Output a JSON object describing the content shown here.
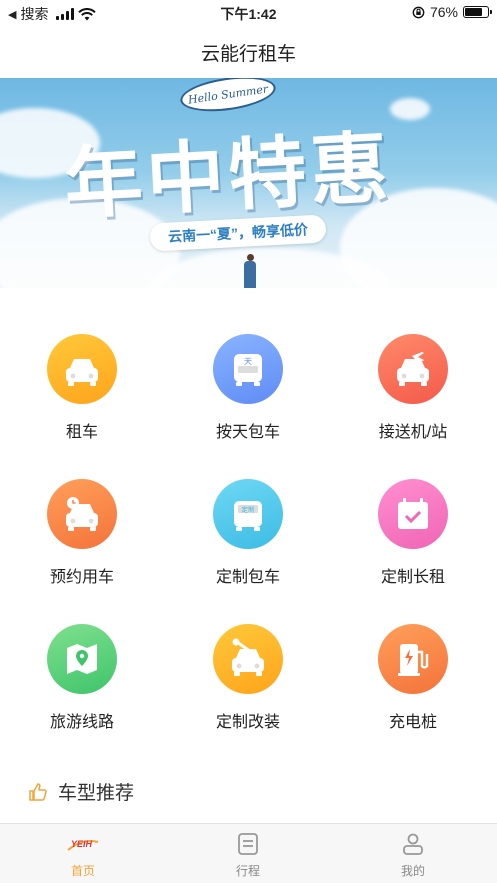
{
  "status_bar": {
    "back_app": "搜索",
    "time": "下午1:42",
    "battery_percent": "76%",
    "battery_level": 0.76
  },
  "nav": {
    "title": "云能行租车"
  },
  "banner": {
    "badge": "Hello Summer",
    "headline": "年中特惠",
    "slogan": "云南一“夏”，畅享低价"
  },
  "services": [
    {
      "label": "租车",
      "icon": "car-icon",
      "color_from": "#ffc93a",
      "color_to": "#ffa41c"
    },
    {
      "label": "按天包车",
      "icon": "day-bus-icon",
      "color_from": "#8ab4ff",
      "color_to": "#5e8cf5"
    },
    {
      "label": "接送机/站",
      "icon": "airport-car-icon",
      "color_from": "#ff8a6a",
      "color_to": "#f45a4a"
    },
    {
      "label": "预约用车",
      "icon": "clock-car-icon",
      "color_from": "#ff9f5a",
      "color_to": "#f4733a"
    },
    {
      "label": "定制包车",
      "icon": "custom-bus-icon",
      "color_from": "#6fd8f4",
      "color_to": "#3cbce4"
    },
    {
      "label": "定制长租",
      "icon": "calendar-check-icon",
      "color_from": "#ff8fd0",
      "color_to": "#f065b5"
    },
    {
      "label": "旅游线路",
      "icon": "map-pin-icon",
      "color_from": "#7fe08f",
      "color_to": "#3fc46a"
    },
    {
      "label": "定制改装",
      "icon": "wrench-car-icon",
      "color_from": "#ffc93a",
      "color_to": "#ffa41c"
    },
    {
      "label": "充电桩",
      "icon": "charging-pile-icon",
      "color_from": "#ff9f5a",
      "color_to": "#f4733a"
    }
  ],
  "recommend": {
    "title": "车型推荐",
    "icon": "thumbs-up-icon",
    "accent": "#f3a43a"
  },
  "tabs": [
    {
      "label": "首页",
      "icon": "yeih-logo-icon",
      "active": true
    },
    {
      "label": "行程",
      "icon": "itinerary-icon",
      "active": false
    },
    {
      "label": "我的",
      "icon": "profile-icon",
      "active": false
    }
  ]
}
